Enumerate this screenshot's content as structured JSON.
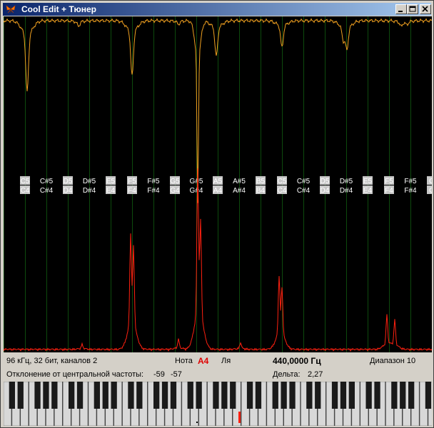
{
  "window": {
    "title": "Cool Edit + Тюнер",
    "icon": "butterfly-icon",
    "buttons": [
      "minimize-icon",
      "maximize-icon",
      "close-icon"
    ]
  },
  "colors": {
    "background": "#000000",
    "grid_line": "#0d4a0d",
    "top_curve": "#f0a020",
    "bottom_spectrum": "#ff2010",
    "key_white": "#d8d8d8",
    "key_black": "#1a1a1a",
    "marker": "#ff2010",
    "note_label_bg": "#c8c8c8"
  },
  "note_labels": [
    [
      "",
      ""
    ],
    [
      "C5",
      "C4"
    ],
    [
      "C#5",
      "C#4"
    ],
    [
      "D5",
      "D4"
    ],
    [
      "D#5",
      "D#4"
    ],
    [
      "E5",
      "E4"
    ],
    [
      "F5",
      "F4"
    ],
    [
      "F#5",
      "F#4"
    ],
    [
      "G5",
      "G4"
    ],
    [
      "G#5",
      "G#4"
    ],
    [
      "A5",
      "A4"
    ],
    [
      "A#5",
      "A#4"
    ],
    [
      "B5",
      "B4"
    ],
    [
      "C5",
      "C4"
    ],
    [
      "C#5",
      "C#4"
    ],
    [
      "D5",
      "D4"
    ],
    [
      "D#5",
      "D#4"
    ],
    [
      "E5",
      "E4"
    ],
    [
      "F5",
      "F4"
    ],
    [
      "F#5",
      "F#4"
    ],
    [
      "G",
      "G"
    ]
  ],
  "info": {
    "format": "96 кГц,  32 бит,  каналов 2",
    "note_label": "Нота",
    "note_value": "A4",
    "note_name": "Ля",
    "frequency": "440,0000 Гц",
    "range": "Диапазон 10",
    "deviation_label": "Отклонение от центральной частоты:",
    "deviation_1": "-59",
    "deviation_2": "-57",
    "delta_label": "Дельта:",
    "delta_value": "2,27"
  },
  "piano": {
    "highlighted_key": "A4"
  }
}
